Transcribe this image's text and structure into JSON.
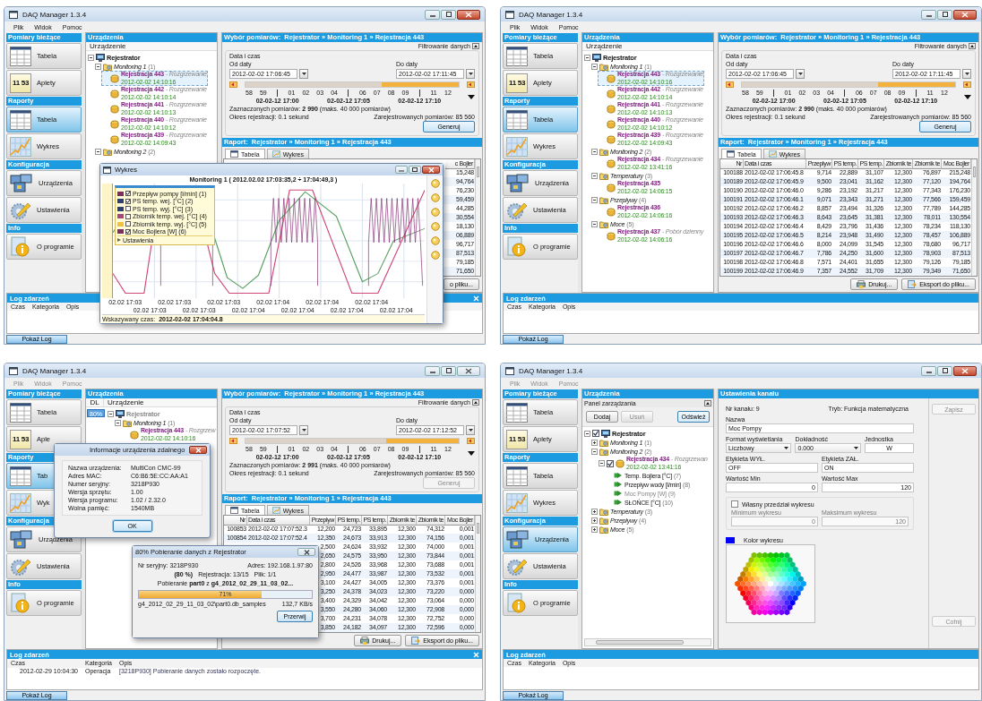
{
  "screens": [
    {
      "title": "DAQ Manager 1.3.4",
      "active": true,
      "menu": [
        {
          "label": "Plik",
          "disabled": false
        },
        {
          "label": "Widok",
          "disabled": false
        },
        {
          "label": "Pomoc",
          "disabled": false
        }
      ],
      "sidebar": [
        {
          "header": "Pomiary bieżące",
          "items": [
            {
              "label": "Tabela",
              "kind": "table",
              "selected": false
            },
            {
              "label": "Aplety",
              "kind": "applet",
              "icon_text": "11 53",
              "selected": false
            }
          ]
        },
        {
          "header": "Raporty",
          "items": [
            {
              "label": "Tabela",
              "kind": "table",
              "selected": true
            },
            {
              "label": "Wykres",
              "kind": "chart",
              "selected": false
            }
          ]
        },
        {
          "header": "Konfiguracja",
          "items": [
            {
              "label": "Urządzenia",
              "kind": "devices",
              "selected": false
            },
            {
              "label": "Ustawienia",
              "kind": "settings",
              "selected": false
            }
          ]
        },
        {
          "header": "Info",
          "items": [
            {
              "label": "O programie",
              "kind": "info",
              "selected": false
            }
          ]
        }
      ],
      "devices": {
        "title": "Urządzenia",
        "columns": [
          "Urządzenie"
        ],
        "tree": [
          {
            "kind": "device",
            "label": "Rejestrator",
            "expanded": true,
            "selected": false,
            "disabled": false,
            "children": [
              {
                "kind": "group",
                "label": "Monitoring 1",
                "count": "(1)",
                "expanded": true,
                "selected": false,
                "children": [
                  {
                    "kind": "registration",
                    "label": "Rejestracja 443",
                    "note": "- Rozgrzewanie",
                    "date": "2012-02-02 14:10:16",
                    "selected": true
                  },
                  {
                    "kind": "registration",
                    "label": "Rejestracja 442",
                    "note": "- Rozgrzewanie",
                    "date": "2012-02-02 14:10:14",
                    "selected": false
                  },
                  {
                    "kind": "registration",
                    "label": "Rejestracja 441",
                    "note": "- Rozgrzewanie",
                    "date": "2012-02-02 14:10:13",
                    "selected": false
                  },
                  {
                    "kind": "registration",
                    "label": "Rejestracja 440",
                    "note": "- Rozgrzewanie",
                    "date": "2012-02-02 14:10:12",
                    "selected": false
                  },
                  {
                    "kind": "registration",
                    "label": "Rejestracja 439",
                    "note": "- Rozgrzewanie",
                    "date": "2012-02-02 14:09:43",
                    "selected": false
                  }
                ]
              },
              {
                "kind": "group",
                "label": "Monitoring 2",
                "count": "(2)",
                "expanded": true,
                "selected": false
              }
            ]
          }
        ]
      },
      "main": {
        "kind": "report",
        "header": "Wybór pomiarów:  Rejestrator » Monitoring 1 » Rejestracja 443",
        "filter": "Filtrowanie danych",
        "group": "Data i czas",
        "from_label": "Od daty",
        "from": "2012-02-02 17:06:45",
        "to_label": "Do daty",
        "to": "2012-02-02 17:11:45",
        "timeline": {
          "level": 0.36,
          "ticks": [
            {
              "label": "58",
              "major": false
            },
            {
              "label": "59",
              "major": false
            },
            {
              "label": "02-02-12 17:00",
              "major": true
            },
            {
              "label": "01",
              "major": false
            },
            {
              "label": "02",
              "major": false
            },
            {
              "label": "03",
              "major": false
            },
            {
              "label": "04",
              "major": false
            },
            {
              "label": "02-02-12 17:05",
              "major": true
            },
            {
              "label": "06",
              "major": false
            },
            {
              "label": "07",
              "major": false
            },
            {
              "label": "08",
              "major": false
            },
            {
              "label": "09",
              "major": false
            },
            {
              "label": "02-02-12 17:10",
              "major": true
            },
            {
              "label": "11",
              "major": false
            },
            {
              "label": "12",
              "major": false
            }
          ]
        },
        "selected_count": "Zaznaczonych pomiarów: **2 990** (maks. 40 000 pomiarów)",
        "registered_count": "Zarejestrowanych pomiarów: 85 560",
        "period": "Okres rejestracji: 0.1 sekund",
        "generate": {
          "label": "Generuj",
          "disabled": false
        },
        "report_header": "Raport:  Rejestrator » Monitoring 1 » Rejestracja 443",
        "tabs": [
          {
            "label": "Tabela",
            "kind": "table",
            "selected": true
          },
          {
            "label": "Wykres",
            "kind": "chart",
            "selected": false
          }
        ],
        "table": {
          "columns": [
            "c Bojler"
          ],
          "rows": [
            {
              "cells": [
                "15,248"
              ]
            },
            {
              "cells": [
                "94,764"
              ]
            },
            {
              "cells": [
                "76,230"
              ]
            },
            {
              "cells": [
                "59,459"
              ]
            },
            {
              "cells": [
                "44,285"
              ]
            },
            {
              "cells": [
                "30,554"
              ]
            },
            {
              "cells": [
                "18,130"
              ]
            },
            {
              "cells": [
                "06,889"
              ]
            },
            {
              "cells": [
                "96,717"
              ]
            },
            {
              "cells": [
                "87,513"
              ]
            },
            {
              "cells": [
                "79,185"
              ]
            },
            {
              "cells": [
                "71,650"
              ]
            }
          ]
        },
        "buttons": [
          {
            "label": "o pliku...",
            "kind": "plain"
          }
        ]
      },
      "log": {
        "title": "Log zdarzeń",
        "close": true,
        "columns": [
          "Czas",
          "Kategoria",
          "Opis"
        ]
      },
      "status": {
        "button": "Pokaż Log"
      },
      "overlays": [
        {
          "kind": "chart_window",
          "title": "Wykres",
          "chart_title": "Monitoring 1 ( 2012.02.02 17:03:35,2 ÷ 17:04:49,3 )",
          "legend": [
            {
              "label": "Przepływ pompy [l/min] (1)",
              "checked": true,
              "color": "#7a2d5e"
            },
            {
              "label": "PS temp. wej. [°C] (2)",
              "checked": true,
              "color": "#2e3f6e"
            },
            {
              "label": "PS temp. wyj. [°C] (3)",
              "checked": false,
              "color": "#2e3f6e"
            },
            {
              "label": "Zbiornik temp. wej. [°C] (4)",
              "checked": false,
              "color": "#a8457a"
            },
            {
              "label": "Zbiornik temp. wyj. [°C] (5)",
              "checked": false,
              "color": "#f0c040"
            },
            {
              "label": "Moc Bojlera [W] (6)",
              "checked": true,
              "color": "#7a2d5e"
            }
          ],
          "legend_footer": "Ustawienia",
          "x_labels": [
            "02.02 17:03",
            "02.02 17:03",
            "02.02 17:03",
            "02.02 17:03",
            "02.02 17:03",
            "02.02 17:04",
            "02.02 17:04",
            "02.02 17:04",
            "02.02 17:04",
            "02.02 17:04",
            "02.02 17:04",
            "02.02 17:04"
          ],
          "cursor_label": "Wskazywany czas:",
          "cursor_time": "2012-02-02 17:04:04.8"
        }
      ]
    },
    {
      "title": "DAQ Manager 1.3.4",
      "active": true,
      "menu": [
        {
          "label": "Plik",
          "disabled": false
        },
        {
          "label": "Widok",
          "disabled": false
        },
        {
          "label": "Pomoc",
          "disabled": false
        }
      ],
      "sidebar": [
        {
          "header": "Pomiary bieżące",
          "items": [
            {
              "label": "Tabela",
              "kind": "table",
              "selected": false
            },
            {
              "label": "Aplety",
              "kind": "applet",
              "icon_text": "11 53",
              "selected": false
            }
          ]
        },
        {
          "header": "Raporty",
          "items": [
            {
              "label": "Tabela",
              "kind": "table",
              "selected": true
            },
            {
              "label": "Wykres",
              "kind": "chart",
              "selected": false
            }
          ]
        },
        {
          "header": "Konfiguracja",
          "items": [
            {
              "label": "Urządzenia",
              "kind": "devices",
              "selected": false
            },
            {
              "label": "Ustawienia",
              "kind": "settings",
              "selected": false
            }
          ]
        },
        {
          "header": "Info",
          "items": [
            {
              "label": "O programie",
              "kind": "info",
              "selected": false
            }
          ]
        }
      ],
      "devices": {
        "title": "Urządzenia",
        "columns": [
          "Urządzenie"
        ],
        "tree": [
          {
            "kind": "device",
            "label": "Rejestrator",
            "expanded": true,
            "selected": false,
            "disabled": false,
            "children": [
              {
                "kind": "group",
                "label": "Monitoring 1",
                "count": "(1)",
                "expanded": true,
                "selected": false,
                "children": [
                  {
                    "kind": "registration",
                    "label": "Rejestracja 443",
                    "note": "- Rozgrzewanie",
                    "date": "2012-02-02 14:10:16",
                    "selected": true
                  },
                  {
                    "kind": "registration",
                    "label": "Rejestracja 442",
                    "note": "- Rozgrzewanie",
                    "date": "2012-02-02 14:10:14",
                    "selected": false
                  },
                  {
                    "kind": "registration",
                    "label": "Rejestracja 441",
                    "note": "- Rozgrzewanie",
                    "date": "2012-02-02 14:10:13",
                    "selected": false
                  },
                  {
                    "kind": "registration",
                    "label": "Rejestracja 440",
                    "note": "- Rozgrzewanie",
                    "date": "2012-02-02 14:10:12",
                    "selected": false
                  },
                  {
                    "kind": "registration",
                    "label": "Rejestracja 439",
                    "note": "- Rozgrzewanie",
                    "date": "2012-02-02 14:09:43",
                    "selected": false
                  }
                ]
              },
              {
                "kind": "group",
                "label": "Monitoring 2",
                "count": "(2)",
                "expanded": true,
                "selected": false,
                "children": [
                  {
                    "kind": "registration",
                    "label": "Rejestracja 434",
                    "note": "- Rozgrzewanie",
                    "date": "2012-02-02 13:41:16",
                    "selected": false
                  }
                ]
              },
              {
                "kind": "group",
                "label": "Temperatury",
                "count": "(3)",
                "expanded": true,
                "selected": false,
                "children": [
                  {
                    "kind": "registration",
                    "label": "Rejestracja 435",
                    "date": "2012-02-02 14:06:15",
                    "selected": false
                  }
                ]
              },
              {
                "kind": "group",
                "label": "Przepływy",
                "count": "(4)",
                "expanded": true,
                "selected": false,
                "children": [
                  {
                    "kind": "registration",
                    "label": "Rejestracja 436",
                    "date": "2012-02-02 14:06:16",
                    "selected": false
                  }
                ]
              },
              {
                "kind": "group",
                "label": "Moce",
                "count": "(5)",
                "expanded": true,
                "selected": false,
                "children": [
                  {
                    "kind": "registration",
                    "label": "Rejestracja 437",
                    "note": "- Pobór dzienny",
                    "date": "2012-02-02 14:06:16",
                    "selected": false
                  }
                ]
              }
            ]
          }
        ]
      },
      "main": {
        "kind": "report",
        "header": "Wybór pomiarów:  Rejestrator » Monitoring 1 » Rejestracja 443",
        "filter": "Filtrowanie danych",
        "group": "Data i czas",
        "from_label": "Od daty",
        "from": "2012-02-02 17:06:45",
        "to_label": "Do daty",
        "to": "2012-02-02 17:11:45",
        "timeline": {
          "level": 0.36,
          "ticks": [
            {
              "label": "58",
              "major": false
            },
            {
              "label": "59",
              "major": false
            },
            {
              "label": "02-02-12 17:00",
              "major": true
            },
            {
              "label": "01",
              "major": false
            },
            {
              "label": "02",
              "major": false
            },
            {
              "label": "03",
              "major": false
            },
            {
              "label": "04",
              "major": false
            },
            {
              "label": "02-02-12 17:05",
              "major": true
            },
            {
              "label": "06",
              "major": false
            },
            {
              "label": "07",
              "major": false
            },
            {
              "label": "08",
              "major": false
            },
            {
              "label": "09",
              "major": false
            },
            {
              "label": "02-02-12 17:10",
              "major": true
            },
            {
              "label": "11",
              "major": false
            },
            {
              "label": "12",
              "major": false
            }
          ]
        },
        "selected_count": "Zaznaczonych pomiarów: **2 990** (maks. 40 000 pomiarów)",
        "registered_count": "Zarejestrowanych pomiarów: 85 560",
        "period": "Okres rejestracji: 0.1 sekund",
        "generate": {
          "label": "Generuj",
          "disabled": false
        },
        "report_header": "Raport:  Rejestrator » Monitoring 1 » Rejestracja 443",
        "tabs": [
          {
            "label": "Tabela",
            "kind": "table",
            "selected": true
          },
          {
            "label": "Wykres",
            "kind": "chart",
            "selected": false
          }
        ],
        "table": {
          "columns": [
            "Nr",
            "Data i czas",
            "Przepływ",
            "PS temp.",
            "PS temp.",
            "Zbiornik te",
            "Zbiornik te",
            "Moc Bojler"
          ],
          "rows": [
            {
              "cells": [
                "100188",
                "2012-02-02 17:06:45.8",
                "9,714",
                "22,889",
                "31,107",
                "12,300",
                "76,897",
                "215,248"
              ]
            },
            {
              "cells": [
                "100189",
                "2012-02-02 17:06:45.9",
                "9,500",
                "23,041",
                "31,162",
                "12,300",
                "77,120",
                "194,764"
              ]
            },
            {
              "cells": [
                "100190",
                "2012-02-02 17:06:46.0",
                "9,286",
                "23,192",
                "31,217",
                "12,300",
                "77,343",
                "176,230"
              ]
            },
            {
              "cells": [
                "100191",
                "2012-02-02 17:06:46.1",
                "9,071",
                "23,343",
                "31,271",
                "12,300",
                "77,566",
                "159,459"
              ]
            },
            {
              "cells": [
                "100192",
                "2012-02-02 17:06:46.2",
                "8,857",
                "23,494",
                "31,326",
                "12,300",
                "77,789",
                "144,285"
              ]
            },
            {
              "cells": [
                "100193",
                "2012-02-02 17:06:46.3",
                "8,643",
                "23,645",
                "31,381",
                "12,300",
                "78,011",
                "130,554"
              ]
            },
            {
              "cells": [
                "100194",
                "2012-02-02 17:06:46.4",
                "8,429",
                "23,796",
                "31,436",
                "12,300",
                "78,234",
                "118,130"
              ]
            },
            {
              "cells": [
                "100195",
                "2012-02-02 17:06:46.5",
                "8,214",
                "23,948",
                "31,490",
                "12,300",
                "78,457",
                "106,889"
              ]
            },
            {
              "cells": [
                "100196",
                "2012-02-02 17:06:46.6",
                "8,000",
                "24,099",
                "31,545",
                "12,300",
                "78,680",
                "96,717"
              ]
            },
            {
              "cells": [
                "100197",
                "2012-02-02 17:06:46.7",
                "7,786",
                "24,250",
                "31,600",
                "12,300",
                "78,903",
                "87,513"
              ]
            },
            {
              "cells": [
                "100198",
                "2012-02-02 17:06:46.8",
                "7,571",
                "24,401",
                "31,655",
                "12,300",
                "79,126",
                "79,185"
              ]
            },
            {
              "cells": [
                "100199",
                "2012-02-02 17:06:46.9",
                "7,357",
                "24,552",
                "31,709",
                "12,300",
                "79,349",
                "71,650"
              ]
            }
          ]
        },
        "buttons": [
          {
            "label": "Drukuj...",
            "kind": "print"
          },
          {
            "label": "Eksport do pliku...",
            "kind": "export"
          }
        ]
      },
      "log": {
        "title": "Log zdarzeń",
        "close": false,
        "columns": [
          "Czas",
          "Kategoria",
          "Opis"
        ]
      },
      "status": {
        "button": "Pokaż Log"
      }
    },
    {
      "title": "DAQ Manager 1.3.4",
      "active": false,
      "menu": [
        {
          "label": "Plik",
          "disabled": true
        },
        {
          "label": "Widok",
          "disabled": true
        },
        {
          "label": "Pomoc",
          "disabled": true
        }
      ],
      "sidebar": [
        {
          "header": "Pomiary bieżące",
          "items": [
            {
              "label": "Tabela",
              "kind": "table",
              "selected": false
            },
            {
              "label": "Aple",
              "kind": "applet",
              "icon_text": "11 53",
              "selected": false
            }
          ]
        },
        {
          "header": "Raporty",
          "items": [
            {
              "label": "Tab",
              "kind": "table",
              "selected": true
            },
            {
              "label": "Wyk",
              "kind": "chart",
              "selected": false
            }
          ]
        },
        {
          "header": "Konfiguracja",
          "items": [
            {
              "label": "Urządzenia",
              "kind": "devices",
              "selected": false
            },
            {
              "label": "Ustawienia",
              "kind": "settings",
              "selected": false
            }
          ]
        },
        {
          "header": "Info",
          "items": [
            {
              "label": "O programie",
              "kind": "info",
              "selected": false
            }
          ]
        }
      ],
      "devices": {
        "title": "Urządzenia",
        "columns": [
          "DL",
          "Urządzenie"
        ],
        "tree": [
          {
            "kind": "device",
            "label": "Rejestrator",
            "progress": "80%",
            "expanded": true,
            "selected": false,
            "disabled": true,
            "children": [
              {
                "kind": "group",
                "label": "Monitoring 1",
                "count": "(1)",
                "expanded": true,
                "selected": false,
                "children": [
                  {
                    "kind": "registration",
                    "label": "Rejestracja 443",
                    "note": "- Rozgrzew",
                    "date": "2012-02-02 14:10:16",
                    "selected": false
                  }
                ]
              }
            ]
          }
        ]
      },
      "main": {
        "kind": "report",
        "header": "Wybór pomiarów:  Rejestrator » Monitoring 1 » Rejestracja 443",
        "filter": "Filtrowanie danych",
        "group": "Data i czas",
        "from_label": "Od daty",
        "from": "2012-02-02 17:07:52",
        "to_label": "Do daty",
        "to": "2012-02-02 17:12:52",
        "timeline": {
          "level": 0.34,
          "ticks": [
            {
              "label": "58",
              "major": false
            },
            {
              "label": "59",
              "major": false
            },
            {
              "label": "02-02-12 17:00",
              "major": true
            },
            {
              "label": "01",
              "major": false
            },
            {
              "label": "02",
              "major": false
            },
            {
              "label": "03",
              "major": false
            },
            {
              "label": "04",
              "major": false
            },
            {
              "label": "02-02-12 17:05",
              "major": true
            },
            {
              "label": "06",
              "major": false
            },
            {
              "label": "07",
              "major": false
            },
            {
              "label": "08",
              "major": false
            },
            {
              "label": "09",
              "major": false
            },
            {
              "label": "02-02-12 17:10",
              "major": true
            },
            {
              "label": "11",
              "major": false
            },
            {
              "label": "12",
              "major": false
            }
          ]
        },
        "selected_count": "Zaznaczonych pomiarów: **2 991** (maks. 40 000 pomiarów)",
        "registered_count": "Zarejestrowanych pomiarów: 85 560",
        "period": "Okres rejestracji: 0.1 sekund",
        "generate": {
          "label": "Generuj",
          "disabled": true
        },
        "report_header": "Raport:  Rejestrator » Monitoring 1 » Rejestracja 443",
        "tabs": [
          {
            "label": "Tabela",
            "kind": "table",
            "selected": true
          },
          {
            "label": "Wykres",
            "kind": "chart",
            "selected": false
          }
        ],
        "table": {
          "columns": [
            "Nr",
            "Data i czas",
            "Przepływ",
            "PS temp.",
            "PS temp.",
            "Zbiornik te",
            "Zbiornik te",
            "Moc Bojler"
          ],
          "rows": [
            {
              "cells": [
                "100853",
                "2012-02-02 17:07:52.3",
                "12,200",
                "24,723",
                "33,895",
                "12,300",
                "74,312",
                "0,001"
              ]
            },
            {
              "cells": [
                "100854",
                "2012-02-02 17:07:52.4",
                "12,350",
                "24,673",
                "33,913",
                "12,300",
                "74,156",
                "0,001"
              ]
            },
            {
              "cells": [
                "2,500",
                "24,624",
                "33,932",
                "12,300",
                "74,000",
                "0,001"
              ]
            },
            {
              "cells": [
                "2,650",
                "24,575",
                "33,950",
                "12,300",
                "73,844",
                "0,001"
              ]
            },
            {
              "cells": [
                "2,800",
                "24,526",
                "33,968",
                "12,300",
                "73,688",
                "0,001"
              ]
            },
            {
              "cells": [
                "2,950",
                "24,477",
                "33,987",
                "12,300",
                "73,532",
                "0,001"
              ]
            },
            {
              "cells": [
                "3,100",
                "24,427",
                "34,005",
                "12,300",
                "73,376",
                "0,001"
              ]
            },
            {
              "cells": [
                "3,250",
                "24,378",
                "34,023",
                "12,300",
                "73,220",
                "0,000"
              ]
            },
            {
              "cells": [
                "3,400",
                "24,329",
                "34,042",
                "12,300",
                "73,064",
                "0,000"
              ]
            },
            {
              "cells": [
                "3,550",
                "24,280",
                "34,060",
                "12,300",
                "72,908",
                "0,000"
              ]
            },
            {
              "cells": [
                "3,700",
                "24,231",
                "34,078",
                "12,300",
                "72,752",
                "0,000"
              ]
            },
            {
              "cells": [
                "3,850",
                "24,182",
                "34,097",
                "12,300",
                "72,596",
                "0,000"
              ]
            }
          ]
        },
        "buttons": [
          {
            "label": "Drukuj...",
            "kind": "print"
          },
          {
            "label": "Eksport do pliku...",
            "kind": "export"
          }
        ]
      },
      "log": {
        "title": "Log zdarzeń",
        "close": true,
        "columns": [
          "Czas",
          "Kategoria",
          "Opis"
        ],
        "rows": [
          {
            "cells": [
              "2012-02-29 10:04:30",
              "Operacja",
              "[3218P930] Pobieranie danych zostało rozpoczęte."
            ]
          }
        ]
      },
      "status": {
        "button": "Pokaż Log"
      },
      "overlays": [
        {
          "kind": "info_dialog",
          "title": "Informacje urządzenia zdalnego",
          "fields": [
            {
              "label": "Nazwa urządzenia:",
              "value": "MultiCon CMC-99"
            },
            {
              "label": "Adres MAC:",
              "value": "C6:B6:5E:CC:AA:A1"
            },
            {
              "label": "Numer seryjny:",
              "value": "3218P930"
            },
            {
              "label": "Wersja sprzętu:",
              "value": "1.00"
            },
            {
              "label": "Wersja programu:",
              "value": "1.02 / 2.32.0"
            },
            {
              "label": "Wolna pamięć:",
              "value": "1540MB"
            }
          ],
          "button": "OK"
        },
        {
          "kind": "progress_dialog",
          "title": "80% Pobieranie danych z Rejestrator",
          "serial": "Nr seryjny: 3218P930",
          "address": "Adres: 192.168.1.97:80",
          "percent": "(80 %)",
          "registration": "Rejestracja: 13/15",
          "file": "Plik: 1/1",
          "downloading": "Pobieranie **part0** z **g4_2012_02_29_11_03_02...**",
          "level": 0.71,
          "level_text": "71%",
          "path": "g4_2012_02_29_11_03_02\\part0.db_samples",
          "speed": "132,7 KB/s",
          "button": "Przerwij"
        }
      ]
    },
    {
      "title": "DAQ Manager 1.3.4",
      "active": true,
      "menu": [
        {
          "label": "Plik",
          "disabled": true
        },
        {
          "label": "Widok",
          "disabled": true
        },
        {
          "label": "Pomoc",
          "disabled": true
        }
      ],
      "sidebar": [
        {
          "header": "Pomiary bieżące",
          "items": [
            {
              "label": "Tabela",
              "kind": "table",
              "selected": false
            },
            {
              "label": "Aplety",
              "kind": "applet",
              "icon_text": "11 53",
              "selected": false
            }
          ]
        },
        {
          "header": "Raporty",
          "items": [
            {
              "label": "Tabela",
              "kind": "table",
              "selected": false
            },
            {
              "label": "Wykres",
              "kind": "chart",
              "selected": false
            }
          ]
        },
        {
          "header": "Konfiguracja",
          "items": [
            {
              "label": "Urządzenia",
              "kind": "devices",
              "selected": true
            },
            {
              "label": "Ustawienia",
              "kind": "settings",
              "selected": false
            }
          ]
        },
        {
          "header": "Info",
          "items": [
            {
              "label": "O programie",
              "kind": "info",
              "selected": false
            }
          ]
        }
      ],
      "devices": {
        "title": "Urządzenia",
        "panel": {
          "title": "Panel zarządzania",
          "buttons": [
            {
              "label": "Dodaj",
              "disabled": false
            },
            {
              "label": "Usuń",
              "disabled": true
            },
            {
              "label": "Odśwież",
              "disabled": false
            }
          ]
        },
        "tree": [
          {
            "kind": "device",
            "label": "Rejestrator",
            "checked": true,
            "expanded": true,
            "selected": false,
            "disabled": false,
            "children": [
              {
                "kind": "group",
                "label": "Monitoring 1",
                "count": "(1)",
                "expanded": false,
                "selected": false
              },
              {
                "kind": "group",
                "label": "Monitoring 2",
                "count": "(2)",
                "expanded": true,
                "selected": false,
                "children": [
                  {
                    "kind": "registration",
                    "label": "Rejestracja 434",
                    "note": "- Rozgrzewan",
                    "date": "2012-02-02 13:41:16",
                    "checked": true,
                    "expanded": true,
                    "selected": false,
                    "children": [
                      {
                        "kind": "channel",
                        "label": "Temp. Bojlera [°C]",
                        "count": "(7)",
                        "disabled": false,
                        "selected": false
                      },
                      {
                        "kind": "channel",
                        "label": "Przepływ wody [l/min]",
                        "count": "(8)",
                        "disabled": false,
                        "selected": false
                      },
                      {
                        "kind": "channel",
                        "label": "Moc Pompy [W]",
                        "count": "(9)",
                        "disabled": true,
                        "selected": false
                      },
                      {
                        "kind": "channel",
                        "label": "SŁOŃCE [°C]",
                        "count": "(10)",
                        "disabled": false,
                        "selected": false
                      }
                    ]
                  }
                ]
              },
              {
                "kind": "group",
                "label": "Temperatury",
                "count": "(3)",
                "expanded": false,
                "selected": false
              },
              {
                "kind": "group",
                "label": "Przepływy",
                "count": "(4)",
                "expanded": false,
                "selected": false
              },
              {
                "kind": "group",
                "label": "Moce",
                "count": "(5)",
                "expanded": false,
                "selected": false
              }
            ]
          }
        ]
      },
      "main": {
        "kind": "channel_settings",
        "title": "Ustawienia kanału",
        "channel_no": "Nr kanału: 9",
        "mode": "Tryb: Funkcja matematyczna",
        "rows": [
          {
            "fields": [
              {
                "label": "Nazwa",
                "value": "Moc Pompy",
                "kind": "text"
              }
            ]
          },
          {
            "fields": [
              {
                "label": "Format wyświetlania",
                "value": "Liczbowy",
                "kind": "select"
              },
              {
                "label": "Dokładność",
                "value": "0.000",
                "kind": "select"
              },
              {
                "label": "Jednostka",
                "value": "W",
                "kind": "center"
              }
            ]
          },
          {
            "fields": [
              {
                "label": "Etykieta WYŁ.",
                "value": "OFF",
                "kind": "text"
              },
              {
                "label": "Etykieta ZAŁ.",
                "value": "ON",
                "kind": "text"
              }
            ]
          },
          {
            "fields": [
              {
                "label": "Wartość Min",
                "value": "0",
                "kind": "number"
              },
              {
                "label": "Wartość Max",
                "value": "120",
                "kind": "number"
              }
            ]
          }
        ],
        "range": {
          "label": "Własny przedział wykresu",
          "checked": false,
          "fields": [
            {
              "label": "Minimum wykresu",
              "value": "0"
            },
            {
              "label": "Maksimum wykresu",
              "value": "120"
            }
          ]
        },
        "color": {
          "label": "Kolor wykresu",
          "color": "#0000ff"
        },
        "buttons": [
          {
            "label": "Zapisz",
            "disabled": true
          },
          {
            "label": "Cofnij",
            "disabled": true
          }
        ]
      },
      "log": {
        "title": "Log zdarzeń",
        "close": false,
        "columns": [
          "Czas",
          "Kategoria",
          "Opis"
        ]
      },
      "status": {
        "button": "Pokaż Log"
      }
    }
  ]
}
